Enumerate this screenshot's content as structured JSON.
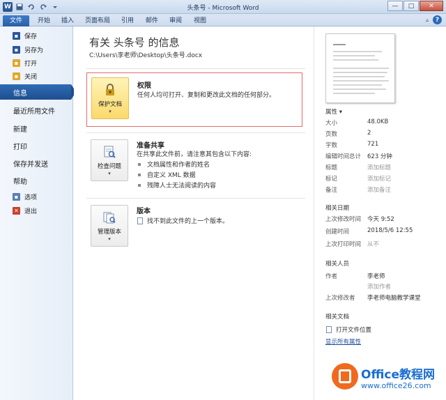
{
  "window": {
    "title": "头条号 - Microsoft Word",
    "controls": {
      "minimize": "—",
      "maximize": "□",
      "close": "✕"
    },
    "qat_word_icon": "W"
  },
  "ribbon": {
    "tabs": [
      "文件",
      "开始",
      "插入",
      "页面布局",
      "引用",
      "邮件",
      "审阅",
      "视图"
    ],
    "help_caret": "▵",
    "help_label": "?"
  },
  "nav": {
    "items_top": [
      {
        "label": "保存",
        "icon": "save-icon",
        "color": "#2b5797"
      },
      {
        "label": "另存为",
        "icon": "save-as-icon",
        "color": "#2b5797"
      },
      {
        "label": "打开",
        "icon": "open-folder-icon",
        "color": "#e0a82c"
      },
      {
        "label": "关闭",
        "icon": "close-doc-icon",
        "color": "#e0a82c"
      }
    ],
    "items_main": [
      "信息",
      "最近所用文件",
      "新建",
      "打印",
      "保存并发送",
      "帮助"
    ],
    "active": "信息",
    "items_bottom": [
      {
        "label": "选项",
        "icon": "options-icon",
        "color": "#5a7fb3"
      },
      {
        "label": "退出",
        "icon": "exit-icon",
        "color": "#c8412c"
      }
    ]
  },
  "info": {
    "title": "有关 头条号 的信息",
    "path": "C:\\Users\\李老师\\Desktop\\头条号.docx",
    "permissions": {
      "button": "保护文档",
      "title": "权限",
      "desc": "任何人均可打开、复制和更改此文档的任何部分。"
    },
    "prepare": {
      "button": "检查问题",
      "title": "准备共享",
      "desc": "在共享此文件前，请注意其包含以下内容:",
      "bullets": [
        "文档属性和作者的姓名",
        "自定义 XML 数据",
        "残障人士无法阅读的内容"
      ]
    },
    "versions": {
      "button": "管理版本",
      "title": "版本",
      "desc": "找不到此文件的上一个版本。"
    },
    "caret": "▾"
  },
  "properties": {
    "header": "属性 ▾",
    "rows": [
      {
        "k": "大小",
        "v": "48.0KB",
        "muted": false
      },
      {
        "k": "页数",
        "v": "2",
        "muted": false
      },
      {
        "k": "字数",
        "v": "721",
        "muted": false
      },
      {
        "k": "编辑时间总计",
        "v": "623 分钟",
        "muted": false
      },
      {
        "k": "标题",
        "v": "添加标题",
        "muted": true
      },
      {
        "k": "标记",
        "v": "添加标记",
        "muted": true
      },
      {
        "k": "备注",
        "v": "添加备注",
        "muted": true
      }
    ],
    "dates_header": "相关日期",
    "dates": [
      {
        "k": "上次修改时间",
        "v": "今天 9:52",
        "muted": false
      },
      {
        "k": "创建时间",
        "v": "2018/5/6 12:55",
        "muted": false
      },
      {
        "k": "上次打印时间",
        "v": "从不",
        "muted": true
      }
    ],
    "people_header": "相关人员",
    "author_label": "作者",
    "author": "李老师",
    "add_author": "添加作者",
    "last_modified_by_label": "上次修改者",
    "last_modified_by": "李老师电脑教学课堂",
    "docs_header": "相关文档",
    "open_location": "打开文件位置",
    "show_all": "显示所有属性"
  },
  "watermark": {
    "line1": "Office教程网",
    "line2": "www.office26.com"
  },
  "colors": {
    "accent": "#2a5fa6",
    "highlight_border": "#e36a6a",
    "gold_button": "#fbd96b",
    "watermark_orange": "#ef6a1f",
    "watermark_blue": "#1a6dd0"
  }
}
